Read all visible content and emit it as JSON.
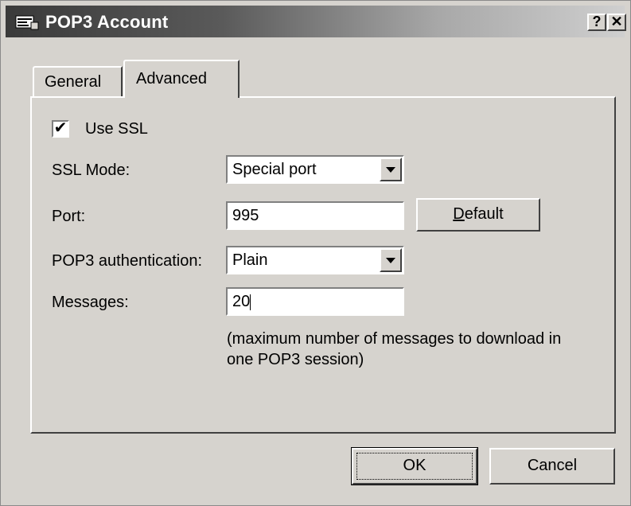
{
  "window": {
    "title": "POP3 Account",
    "help_button": "?",
    "close_button": "✕"
  },
  "tabs": [
    {
      "label": "General",
      "active": false
    },
    {
      "label": "Advanced",
      "active": true
    }
  ],
  "advanced": {
    "use_ssl": {
      "label": "Use SSL",
      "checked": true,
      "mark": "✔"
    },
    "ssl_mode": {
      "label": "SSL Mode:",
      "value": "Special port"
    },
    "port": {
      "label": "Port:",
      "value": "995",
      "default_button": {
        "mnemonic": "D",
        "rest": "efault"
      }
    },
    "auth": {
      "label": "POP3 authentication:",
      "value": "Plain"
    },
    "messages": {
      "label": "Messages:",
      "value": "20",
      "hint_line1": "(maximum number of messages to download in",
      "hint_line2": "one POP3 session)"
    }
  },
  "footer": {
    "ok_label": "OK",
    "cancel_label": "Cancel"
  },
  "colors": {
    "face": "#d6d3ce",
    "titlebar_dark": "#3a3a3a",
    "titlebar_light": "#cfcfcf"
  },
  "icons": {
    "title": "account-window-icon",
    "dropdown": "chevron-down-icon",
    "checkbox": "checkmark-icon"
  }
}
